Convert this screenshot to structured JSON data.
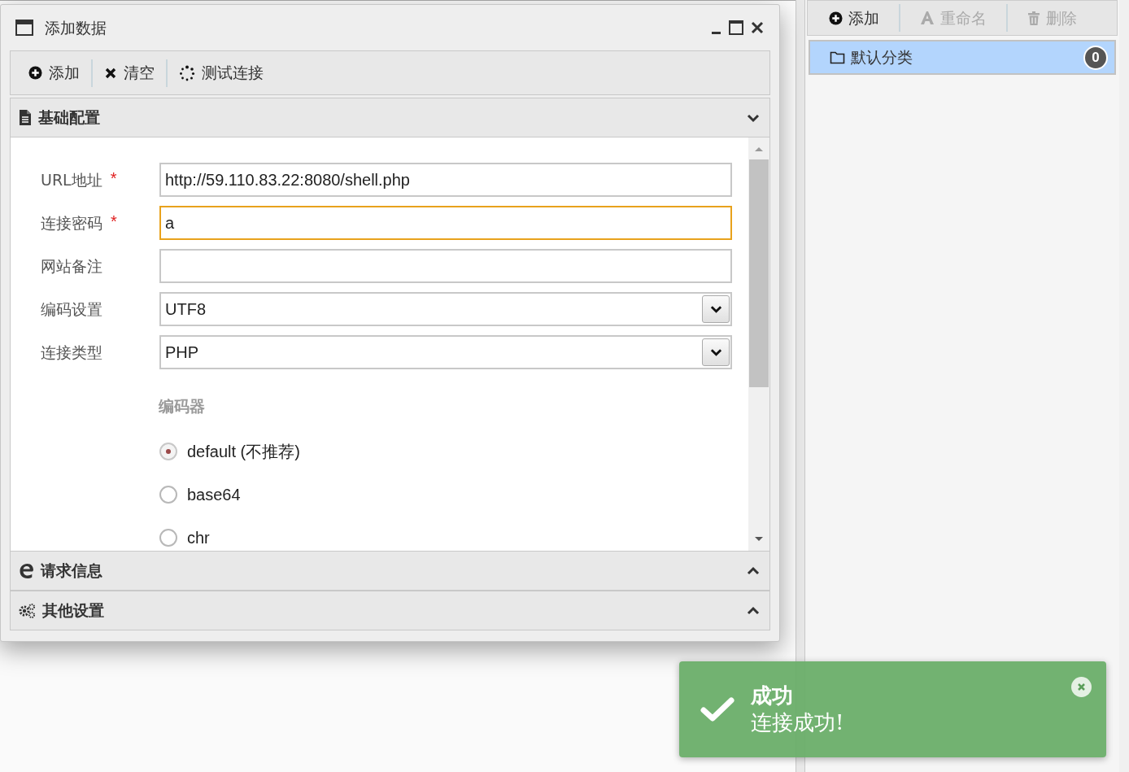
{
  "dialog": {
    "title": "添加数据",
    "toolbar": [
      {
        "kind": "add",
        "label": "添加"
      },
      {
        "kind": "clear",
        "label": "清空"
      },
      {
        "kind": "test",
        "label": "测试连接"
      }
    ],
    "sections": [
      {
        "kind": "basic",
        "title": "基础配置",
        "expanded": true
      },
      {
        "kind": "request",
        "title": "请求信息",
        "expanded": false
      },
      {
        "kind": "other",
        "title": "其他设置",
        "expanded": false
      }
    ],
    "form": {
      "fields": [
        {
          "kind": "text",
          "label": "URL地址",
          "required_mark": "*",
          "value": "http://59.110.83.22:8080/shell.php",
          "focused": false
        },
        {
          "kind": "text",
          "label": "连接密码",
          "required_mark": "*",
          "value": "a",
          "focused": true
        },
        {
          "kind": "text",
          "label": "网站备注",
          "focused": false
        },
        {
          "kind": "select",
          "label": "编码设置",
          "value": "UTF8",
          "focused": false
        },
        {
          "kind": "select",
          "label": "连接类型",
          "value": "PHP",
          "focused": false
        }
      ],
      "encoder": {
        "label": "编码器",
        "options": [
          {
            "label": "default (不推荐)",
            "selected": true
          },
          {
            "label": "base64",
            "selected": false
          },
          {
            "label": "chr",
            "selected": false
          }
        ]
      }
    }
  },
  "category_panel": {
    "toolbar": [
      {
        "kind": "add",
        "label": "添加",
        "disabled": false
      },
      {
        "kind": "rename",
        "label": "重命名",
        "disabled": true
      },
      {
        "kind": "delete",
        "label": "删除",
        "disabled": true
      }
    ],
    "categories": [
      {
        "label": "默认分类",
        "count": "0",
        "selected": true
      }
    ]
  },
  "toast": {
    "title": "成功",
    "message": "连接成功!"
  }
}
